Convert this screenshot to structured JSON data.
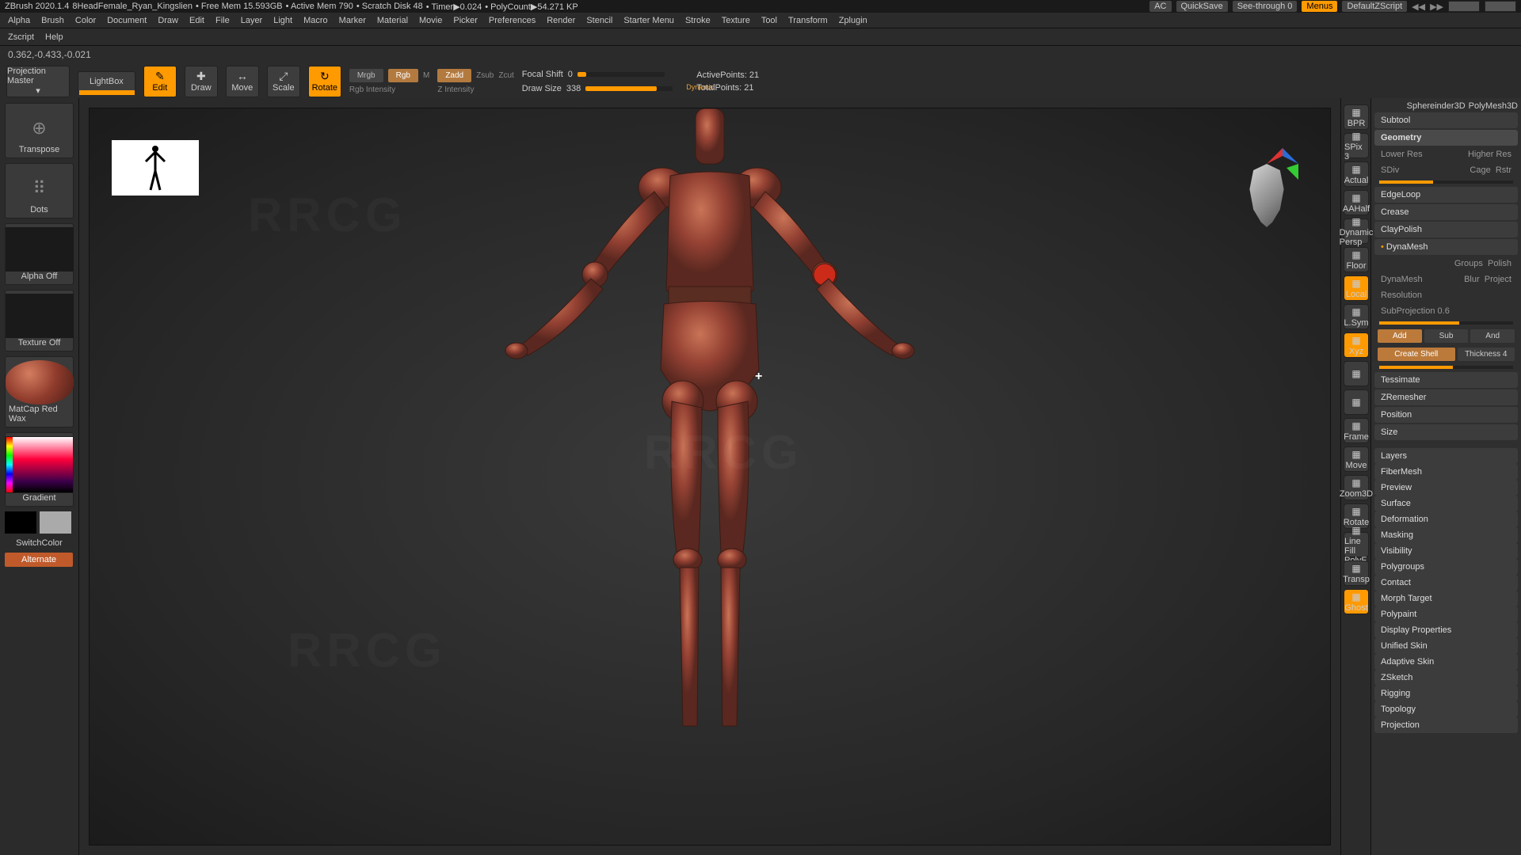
{
  "status": {
    "app_version": "ZBrush 2020.1.4",
    "filename": "8HeadFemale_Ryan_Kingslien",
    "free_mem": "Free Mem 15.593GB",
    "active_mem": "Active Mem 790",
    "scratch": "Scratch Disk 48",
    "timer": "Timer▶0.024",
    "polycount": "PolyCount▶54.271 KP",
    "ac": "AC",
    "quicksave": "QuickSave",
    "seethrough": "See-through  0",
    "menus": "Menus",
    "defaultscript": "DefaultZScript",
    "tool1": "Sphereinder3D",
    "tool2": "PolyMesh3D"
  },
  "menus": [
    "Alpha",
    "Brush",
    "Color",
    "Document",
    "Draw",
    "Edit",
    "File",
    "Layer",
    "Light",
    "Macro",
    "Marker",
    "Material",
    "Movie",
    "Picker",
    "Preferences",
    "Render",
    "Stencil",
    "Starter Menu",
    "Stroke",
    "Texture",
    "Tool",
    "Transform",
    "Zplugin"
  ],
  "menus2": [
    "Zscript",
    "Help"
  ],
  "coords": "0.362,-0.433,-0.021",
  "toolbar": {
    "proj_master": "Projection Master",
    "lightbox": "LightBox",
    "edit": "Edit",
    "draw": "Draw",
    "move": "Move",
    "scale": "Scale",
    "rotate": "Rotate",
    "mrgb": "Mrgb",
    "rgb": "Rgb",
    "m": "M",
    "rgb_intensity": "Rgb Intensity",
    "zadd": "Zadd",
    "zsub": "Zsub",
    "zcut": "Zcut",
    "z_intensity": "Z Intensity",
    "focal_label": "Focal Shift",
    "focal_val": "0",
    "draw_label": "Draw Size",
    "draw_val": "338",
    "dynamic": "Dynamic",
    "active_pts": "ActivePoints:  21",
    "total_pts": "TotalPoints:  21"
  },
  "left": {
    "transpose": "Transpose",
    "dots": "Dots",
    "alpha_off": "Alpha Off",
    "texture_off": "Texture Off",
    "matcap": "MatCap Red Wax",
    "gradient": "Gradient",
    "switchcolor": "SwitchColor",
    "alternate": "Alternate"
  },
  "rshelf": [
    {
      "id": "bpr",
      "label": "BPR",
      "on": false
    },
    {
      "id": "spix",
      "label": "SPix 3",
      "on": false
    },
    {
      "id": "actual",
      "label": "Actual",
      "on": false
    },
    {
      "id": "aahalf",
      "label": "AAHalf",
      "on": false
    },
    {
      "id": "persp",
      "label": "Dynamic Persp",
      "on": false
    },
    {
      "id": "floor",
      "label": "Floor",
      "on": false
    },
    {
      "id": "local",
      "label": "Local",
      "on": true
    },
    {
      "id": "lsym",
      "label": "L.Sym",
      "on": false
    },
    {
      "id": "xyz",
      "label": "Xyz",
      "on": true
    },
    {
      "id": "rot1",
      "label": "",
      "on": false
    },
    {
      "id": "rot2",
      "label": "",
      "on": false
    },
    {
      "id": "frame",
      "label": "Frame",
      "on": false
    },
    {
      "id": "move",
      "label": "Move",
      "on": false
    },
    {
      "id": "zoom3d",
      "label": "Zoom3D",
      "on": false
    },
    {
      "id": "rotate",
      "label": "Rotate",
      "on": false
    },
    {
      "id": "polyf",
      "label": "Line Fill PolyF",
      "on": false
    },
    {
      "id": "transp",
      "label": "Transp",
      "on": false
    },
    {
      "id": "ghost",
      "label": "Ghost",
      "on": true
    }
  ],
  "rpanel": {
    "subtool": "Subtool",
    "geometry": "Geometry",
    "lower_res": "Lower Res",
    "higher_res": "Higher Res",
    "sdiv": "SDiv",
    "cage": "Cage",
    "rstr": "Rstr",
    "edgeloop": "EdgeLoop",
    "crease": "Crease",
    "claypolish": "ClayPolish",
    "dynamesh": "DynaMesh",
    "groups": "Groups",
    "polish": "Polish",
    "dynamesh_row": "DynaMesh",
    "blur": "Blur",
    "project": "Project",
    "resolution": "Resolution",
    "subproj": "SubProjection 0.6",
    "add": "Add",
    "sub": "Sub",
    "and": "And",
    "shell": "Create Shell",
    "thickness": "Thickness 4",
    "tessimate": "Tessimate",
    "zremesher": "ZRemesher",
    "position": "Position",
    "size": "Size",
    "sections": [
      "Layers",
      "FiberMesh",
      "Preview",
      "Surface",
      "Deformation",
      "Masking",
      "Visibility",
      "Polygroups",
      "Contact",
      "Morph Target",
      "Polypaint",
      "Display Properties",
      "Unified Skin",
      "Adaptive Skin",
      "ZSketch",
      "Rigging",
      "Topology",
      "Projection"
    ]
  }
}
